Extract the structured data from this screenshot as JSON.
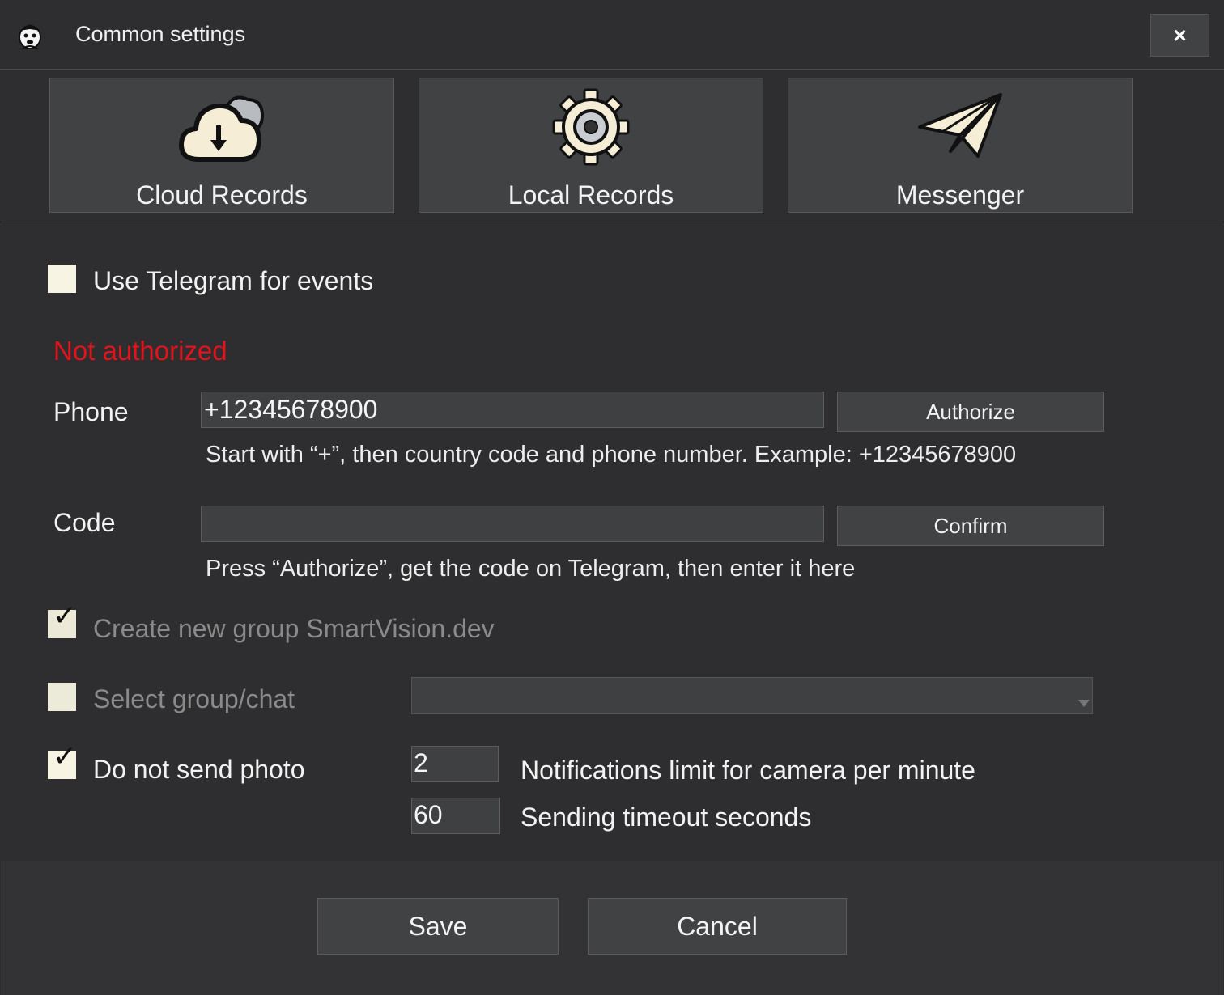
{
  "window": {
    "title": "Common settings",
    "close_label": "×"
  },
  "tabs": [
    {
      "label": "Cloud Records",
      "icon": "cloud-download-icon"
    },
    {
      "label": "Local Records",
      "icon": "gear-icon"
    },
    {
      "label": "Messenger",
      "icon": "paper-plane-icon"
    }
  ],
  "telegram": {
    "use_label": "Use Telegram for events",
    "use_checked": false,
    "status": "Not authorized",
    "phone_label": "Phone",
    "phone_value": "+12345678900",
    "authorize_label": "Authorize",
    "phone_hint": "Start with “+”, then country code and phone number. Example: +12345678900",
    "code_label": "Code",
    "code_value": "",
    "confirm_label": "Confirm",
    "code_hint": "Press “Authorize”, get the code on Telegram, then enter it here",
    "create_group_label": "Create new group SmartVision.dev",
    "create_group_checked": true,
    "select_group_label": "Select group/chat",
    "select_group_checked": false,
    "select_group_value": "",
    "no_photo_label": "Do not send photo",
    "no_photo_checked": true,
    "limit_value": "2",
    "limit_label": "Notifications limit for camera per minute",
    "timeout_value": "60",
    "timeout_label": "Sending timeout seconds"
  },
  "footer": {
    "save_label": "Save",
    "cancel_label": "Cancel"
  },
  "colors": {
    "background": "#2e2e30",
    "button": "#404244",
    "status_error": "#e0141a",
    "checkbox": "#f7f4e3"
  }
}
